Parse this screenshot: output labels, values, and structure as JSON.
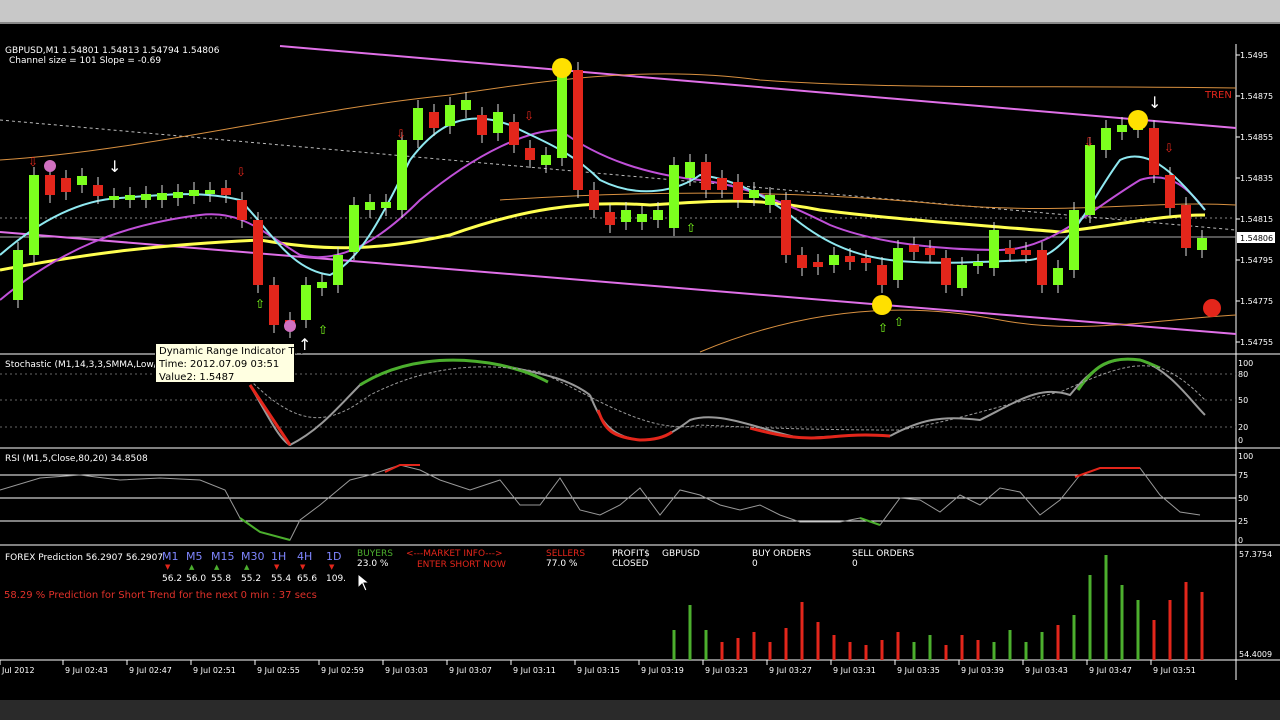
{
  "header": {
    "symbol_line": "GBPUSD,M1  1.54801 1.54813 1.54794 1.54806",
    "channel_line": "Channel size = 101 Slope = -0.69",
    "trend_label": "TREN"
  },
  "price_axis": {
    "labels": [
      "1.5495",
      "1.54875",
      "1.54855",
      "1.54835",
      "1.54815",
      "1.54806",
      "1.54795",
      "1.54775",
      "1.54755"
    ],
    "current": "1.54806"
  },
  "tooltip": {
    "line1": "Dynamic Range Indicator TM",
    "line2": "Time: 2012.07.09 03:51",
    "line3": "Value2: 1.5487"
  },
  "stochastic": {
    "title": "Stochastic (M1,14,3,3,SMMA,Low/High)",
    "levels": [
      "100",
      "80",
      "50",
      "20",
      "0"
    ]
  },
  "rsi": {
    "title": "RSI (M1,5,Close,80,20) 34.8508",
    "levels": [
      "100",
      "75",
      "50",
      "25",
      "0"
    ]
  },
  "forex": {
    "title": "FOREX Prediction 56.2907 56.2907",
    "timeframes": [
      {
        "name": "M1",
        "value": "56.2",
        "dir": "down"
      },
      {
        "name": "M5",
        "value": "56.0",
        "dir": "up"
      },
      {
        "name": "M15",
        "value": "55.8",
        "dir": "up"
      },
      {
        "name": "M30",
        "value": "55.2",
        "dir": "up"
      },
      {
        "name": "1H",
        "value": "55.4",
        "dir": "down"
      },
      {
        "name": "4H",
        "value": "65.6",
        "dir": "down"
      },
      {
        "name": "1D",
        "value": "109.",
        "dir": "down"
      }
    ],
    "buyers_label": "BUYERS",
    "buyers_value": "23.0 %",
    "market_info": "<---MARKET INFO--->",
    "enter_short": "ENTER SHORT NOW",
    "sellers_label": "SELLERS",
    "sellers_value": "77.0 %",
    "profits_label": "PROFIT$",
    "closed_label": "CLOSED",
    "pair_label": "GBPUSD",
    "buy_orders_label": "BUY ORDERS",
    "buy_orders_value": "0",
    "sell_orders_label": "SELL ORDERS",
    "sell_orders_value": "0",
    "prediction_text": "58.29 % Prediction for Short Trend for the next 0 min : 37 secs",
    "axis_top": "57.3754",
    "axis_bottom": "54.4009"
  },
  "time_axis": [
    "Jul 2012",
    "9 Jul 02:43",
    "9 Jul 02:47",
    "9 Jul 02:51",
    "9 Jul 02:55",
    "9 Jul 02:59",
    "9 Jul 03:03",
    "9 Jul 03:07",
    "9 Jul 03:11",
    "9 Jul 03:15",
    "9 Jul 03:19",
    "9 Jul 03:23",
    "9 Jul 03:27",
    "9 Jul 03:31",
    "9 Jul 03:35",
    "9 Jul 03:39",
    "9 Jul 03:43",
    "9 Jul 03:47",
    "9 Jul 03:51"
  ],
  "colors": {
    "bull": "#7cff1e",
    "bear": "#e3261b",
    "magenta": "#e070e8",
    "cyan": "#8fe8f0",
    "yellow": "#ffff50",
    "orange": "#e0a050",
    "grid": "#ffffff"
  }
}
